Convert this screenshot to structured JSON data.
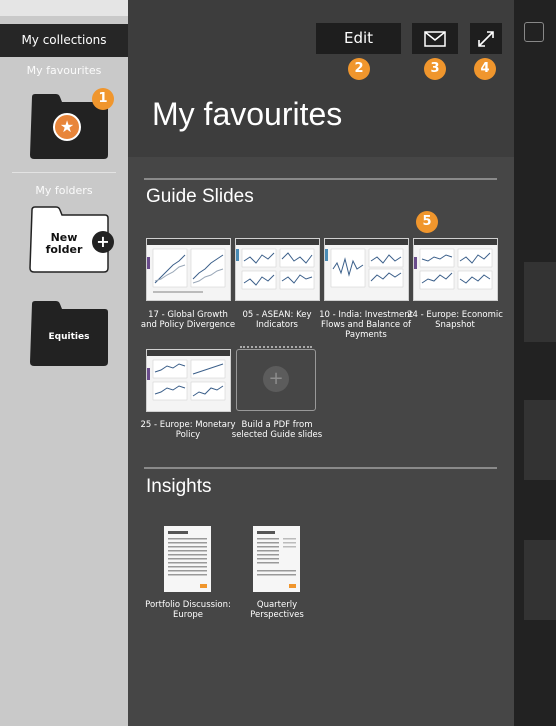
{
  "sidebar": {
    "collections_label": "My collections",
    "favourites_label": "My favourites",
    "folders_label": "My folders",
    "new_folder_label": "New folder",
    "equities_label": "Equities"
  },
  "toolbar": {
    "edit_label": "Edit",
    "badges": [
      "1",
      "2",
      "3",
      "4",
      "5"
    ]
  },
  "main": {
    "title": "My favourites",
    "guide_slides": {
      "heading": "Guide Slides",
      "items": [
        {
          "caption": "17 - Global Growth and Policy Divergence"
        },
        {
          "caption": "05 - ASEAN: Key Indicators"
        },
        {
          "caption": "10 - India: Investment Flows and Balance of Payments"
        },
        {
          "caption": "24 - Europe: Economic Snapshot"
        },
        {
          "caption": "25 - Europe: Monetary Policy"
        }
      ],
      "build_pdf_caption": "Build a PDF from selected Guide slides"
    },
    "insights": {
      "heading": "Insights",
      "items": [
        {
          "caption": "Portfolio Discussion: Europe"
        },
        {
          "caption": "Quarterly Perspectives"
        }
      ]
    }
  },
  "colors": {
    "accent_badge": "#f0962d",
    "sidebar_bg": "#c9c9c9",
    "panel_bg": "#464646",
    "slide_tab_purple": "#6a4c8c",
    "slide_tab_blue": "#4a8bb5"
  }
}
